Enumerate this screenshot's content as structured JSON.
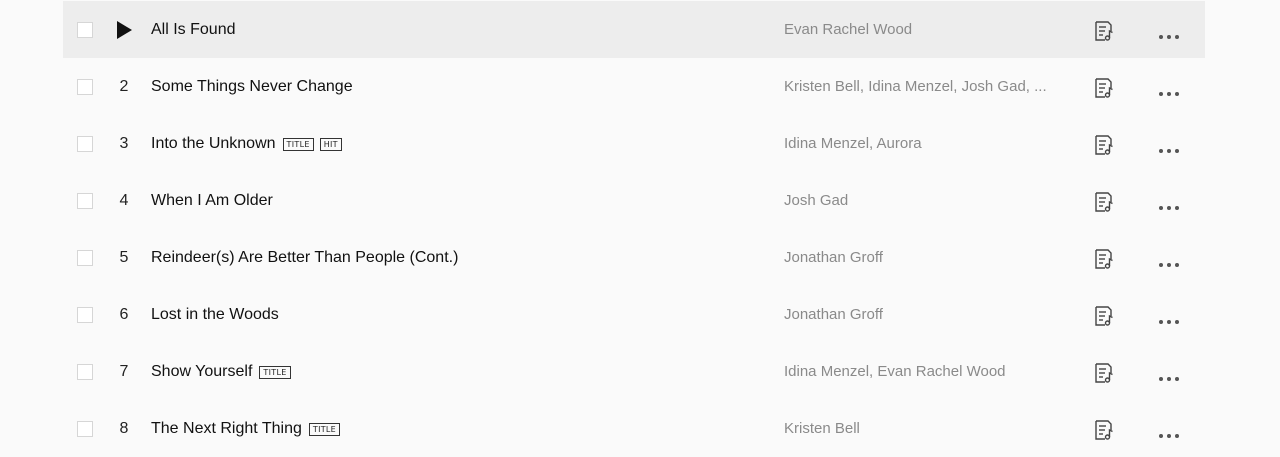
{
  "tracks": [
    {
      "number": "1",
      "title": "All Is Found",
      "badges": [],
      "artist": "Evan Rachel Wood",
      "playing": true
    },
    {
      "number": "2",
      "title": "Some Things Never Change",
      "badges": [],
      "artist": "Kristen Bell, Idina Menzel, Josh Gad, ...",
      "playing": false
    },
    {
      "number": "3",
      "title": "Into the Unknown",
      "badges": [
        "TITLE",
        "HIT"
      ],
      "artist": "Idina Menzel, Aurora",
      "playing": false
    },
    {
      "number": "4",
      "title": "When I Am Older",
      "badges": [],
      "artist": "Josh Gad",
      "playing": false
    },
    {
      "number": "5",
      "title": "Reindeer(s) Are Better Than People (Cont.)",
      "badges": [],
      "artist": "Jonathan Groff",
      "playing": false
    },
    {
      "number": "6",
      "title": "Lost in the Woods",
      "badges": [],
      "artist": "Jonathan Groff",
      "playing": false
    },
    {
      "number": "7",
      "title": "Show Yourself",
      "badges": [
        "TITLE"
      ],
      "artist": "Idina Menzel, Evan Rachel Wood",
      "playing": false
    },
    {
      "number": "8",
      "title": "The Next Right Thing",
      "badges": [
        "TITLE"
      ],
      "artist": "Kristen Bell",
      "playing": false
    }
  ],
  "icons": {
    "play": "play-icon",
    "lyrics": "lyrics-icon",
    "more": "more-icon"
  },
  "colors": {
    "active_row": "#ededed",
    "artist_text": "#8a8a8a",
    "title_text": "#111111"
  }
}
